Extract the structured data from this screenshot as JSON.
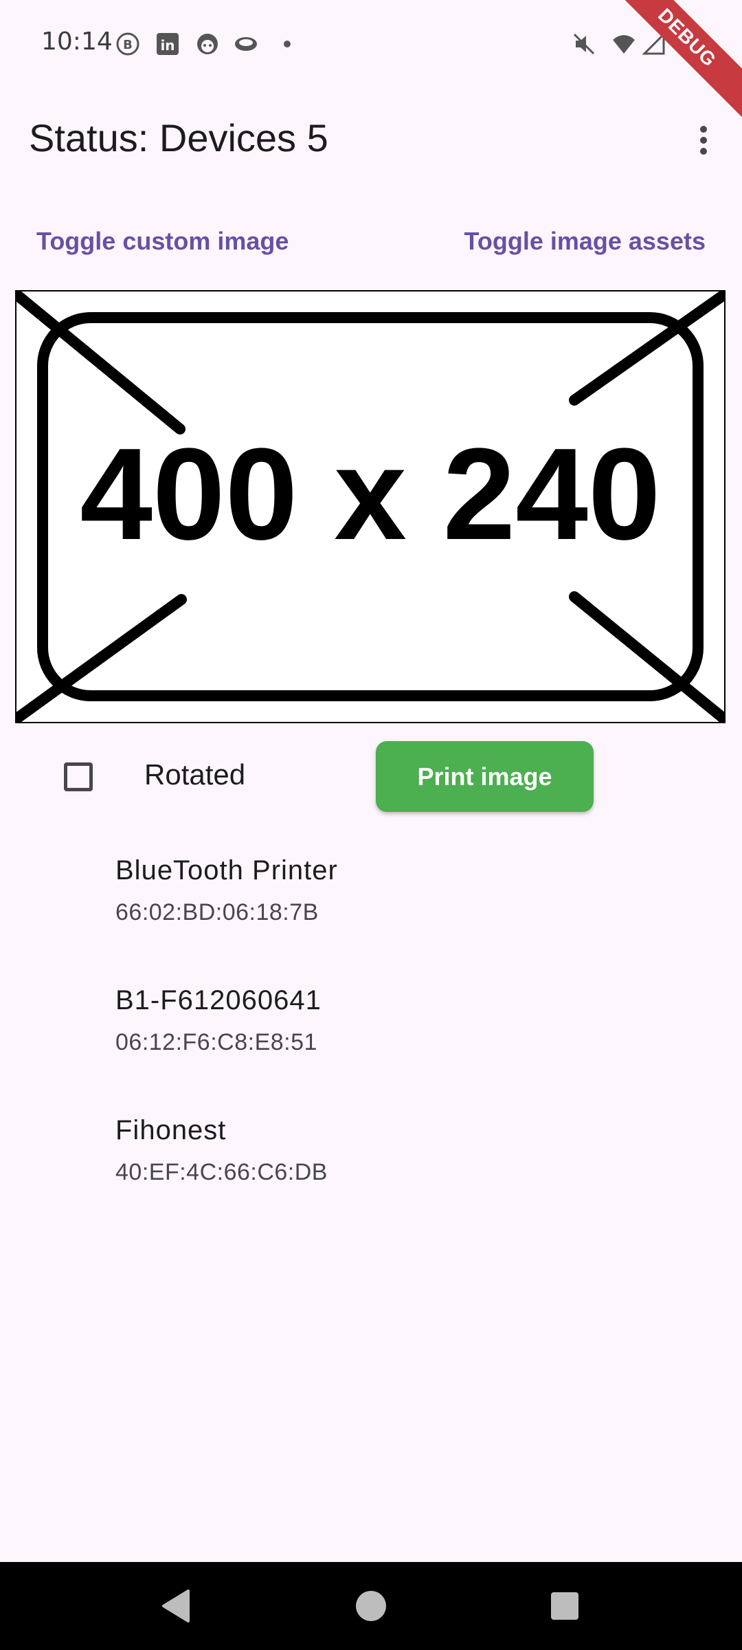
{
  "status_bar": {
    "time": "10:14",
    "icons": [
      "b-badge-icon",
      "linkedin-icon",
      "face-icon",
      "eye-icon",
      "dot-icon",
      "mute-icon",
      "wifi-icon",
      "signal-icon",
      "battery-icon"
    ],
    "debug_label": "DEBUG"
  },
  "app_bar": {
    "title": "Status: Devices 5",
    "menu_icon": "more-vert-icon"
  },
  "toggles": {
    "custom_image": "Toggle custom image",
    "image_assets": "Toggle image assets"
  },
  "image": {
    "placeholder_text": "400 x 240"
  },
  "controls": {
    "rotated_label": "Rotated",
    "rotated_checked": false,
    "print_button": "Print image",
    "print_button_color": "#4caf50"
  },
  "devices": [
    {
      "name": "BlueTooth Printer",
      "address": "66:02:BD:06:18:7B"
    },
    {
      "name": "B1-F612060641",
      "address": "06:12:F6:C8:E8:51"
    },
    {
      "name": "Fihonest",
      "address": "40:EF:4C:66:C6:DB"
    }
  ],
  "nav_bar": {
    "buttons": [
      "back-icon",
      "home-icon",
      "recents-icon"
    ]
  },
  "colors": {
    "background": "#fdf7fd",
    "accent": "#6750a4",
    "debug_ribbon": "#c73a3f"
  }
}
